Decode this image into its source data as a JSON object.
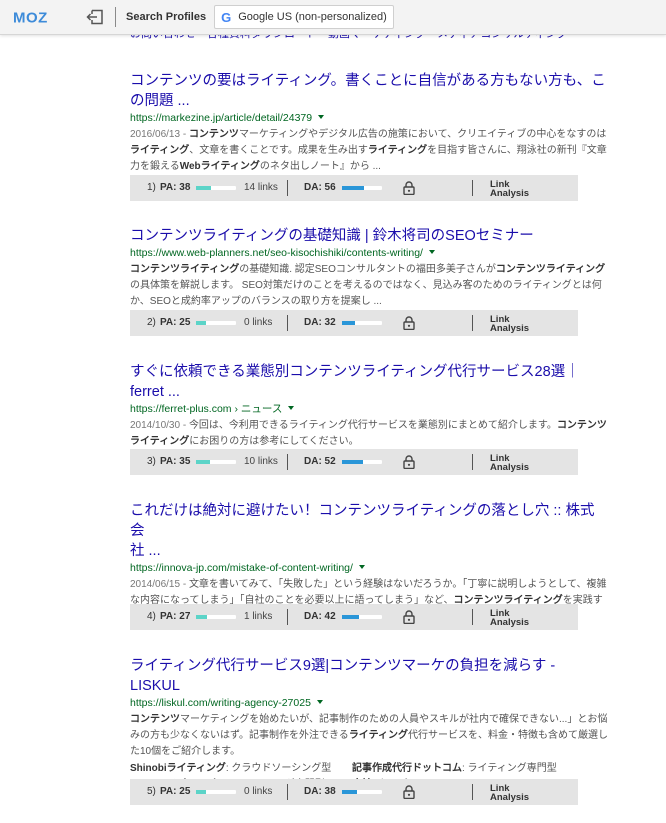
{
  "toolbar": {
    "logo_text": "MOZ",
    "search_profiles_label": "Search Profiles",
    "engine_icon": "G",
    "engine_label": "Google US (non-personalized)",
    "icons": [
      "moz-logo",
      "exit-icon",
      "google-icon"
    ]
  },
  "top_links": "お問い合わせ・各種資料ダウンロード・動画マーケティング・メディアコンサルティング",
  "results": [
    {
      "title_line1": "コンテンツの要はライティング。書くことに自信がある方もない方も、こ",
      "title_line2": "の問題 ...",
      "url": "https://markezine.jp/article/detail/24379",
      "snippet_html": "<span class=\"date\">2016/06/13 - </span><b>コンテンツ</b>マーケティングやデジタル広告の施策において、クリエイティブの中心をなすのは<b>ライティング</b>、文章を書くことです。成果を生み出す<b>ライティング</b>を目指す皆さんに、翔泳社の新刊『文章力を鍛える<b>Webライティング</b>のネタ出しノート』から ...",
      "rank": "1)",
      "pa_label": "PA: 38",
      "pa": 38,
      "links": "14 links",
      "da_label": "DA: 56",
      "da": 56,
      "link_analysis_line1": "Link",
      "link_analysis_line2": "Analysis"
    },
    {
      "title_line1": "コンテンツライティングの基礎知識 | 鈴木将司のSEOセミナー",
      "title_line2": "",
      "url": "https://www.web-planners.net/seo-kisochishiki/contents-writing/",
      "snippet_html": "<b>コンテンツライティング</b>の基礎知識. 認定SEOコンサルタントの福田多美子さんが<b>コンテンツライティング</b>の具体策を解説します。 SEO対策だけのことを考えるのではなく、見込み客のためのライティングとは何か、SEOと成約率アップのバランスの取り方を提案し ...",
      "rank": "2)",
      "pa_label": "PA: 25",
      "pa": 25,
      "links": "0 links",
      "da_label": "DA: 32",
      "da": 32,
      "link_analysis_line1": "Link",
      "link_analysis_line2": "Analysis"
    },
    {
      "title_line1": "すぐに依頼できる業態別コンテンツライティング代行サービス28選｜",
      "title_line2": "ferret ...",
      "url": "https://ferret-plus.com › ニュース",
      "snippet_html": "<span class=\"date\">2014/10/30 - </span>今回は、今利用できるライティング代行サービスを業態別にまとめて紹介します。<b>コンテンツライティング</b>にお困りの方は参考にしてください。",
      "rank": "3)",
      "pa_label": "PA: 35",
      "pa": 35,
      "links": "10 links",
      "da_label": "DA: 52",
      "da": 52,
      "link_analysis_line1": "Link",
      "link_analysis_line2": "Analysis"
    },
    {
      "title_line1": "これだけは絶対に避けたい！コンテンツライティングの落とし穴 :: 株式会",
      "title_line2": "社 ...",
      "url": "https://innova-jp.com/mistake-of-content-writing/",
      "snippet_html": "<span class=\"date\">2014/06/15 - </span>文章を書いてみて、「失敗した」という経験はないだろうか。「丁寧に説明しようとして、複雑な内容になってしまう」「自社のことを必要以上に語ってしまう」など、<b>コンテンツライティング</b>を実践するうえで、はまってしまいがちな「落とし穴」を紹介する。",
      "rank": "4)",
      "pa_label": "PA: 27",
      "pa": 27,
      "links": "1 links",
      "da_label": "DA: 42",
      "da": 42,
      "link_analysis_line1": "Link",
      "link_analysis_line2": "Analysis"
    },
    {
      "title_line1": "ライティング代行サービス9選|コンテンツマーケの負担を減らす - LISKUL",
      "title_line2": "",
      "url": "https://liskul.com/writing-agency-27025",
      "snippet_html": "<b>コンテンツ</b>マーケティングを始めたいが、記事制作のための人員やスキルが社内で確保できない...」とお悩みの方も少なくないはず。記事制作を外注できる<b>ライティング</b>代行サービスを、料金・特徴も含めて厳選した10個をご紹介します。",
      "extra": [
        [
          "<b>Shinobiライティング</b>: クラウドソーシング型",
          "<b>記事作成代行ドットコム</b>: ライティング専門型"
        ],
        [
          "<b>コンテンツウォーカー</b>: ライティング専門型",
          "<b>会社</b>: タイプ"
        ]
      ],
      "rank": "5)",
      "pa_label": "PA: 25",
      "pa": 25,
      "links": "0 links",
      "da_label": "DA: 38",
      "da": 38,
      "link_analysis_line1": "Link",
      "link_analysis_line2": "Analysis"
    }
  ]
}
